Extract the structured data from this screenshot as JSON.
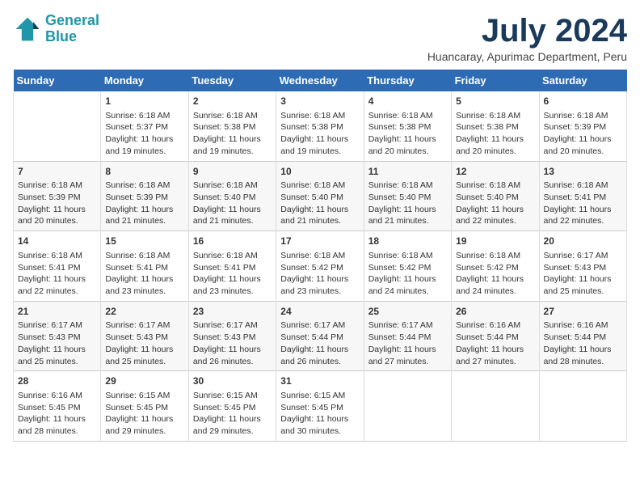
{
  "header": {
    "logo_line1": "General",
    "logo_line2": "Blue",
    "title": "July 2024",
    "subtitle": "Huancaray, Apurimac Department, Peru"
  },
  "columns": [
    "Sunday",
    "Monday",
    "Tuesday",
    "Wednesday",
    "Thursday",
    "Friday",
    "Saturday"
  ],
  "weeks": [
    [
      {
        "num": "",
        "info": ""
      },
      {
        "num": "1",
        "info": "Sunrise: 6:18 AM\nSunset: 5:37 PM\nDaylight: 11 hours\nand 19 minutes."
      },
      {
        "num": "2",
        "info": "Sunrise: 6:18 AM\nSunset: 5:38 PM\nDaylight: 11 hours\nand 19 minutes."
      },
      {
        "num": "3",
        "info": "Sunrise: 6:18 AM\nSunset: 5:38 PM\nDaylight: 11 hours\nand 19 minutes."
      },
      {
        "num": "4",
        "info": "Sunrise: 6:18 AM\nSunset: 5:38 PM\nDaylight: 11 hours\nand 20 minutes."
      },
      {
        "num": "5",
        "info": "Sunrise: 6:18 AM\nSunset: 5:38 PM\nDaylight: 11 hours\nand 20 minutes."
      },
      {
        "num": "6",
        "info": "Sunrise: 6:18 AM\nSunset: 5:39 PM\nDaylight: 11 hours\nand 20 minutes."
      }
    ],
    [
      {
        "num": "7",
        "info": "Sunrise: 6:18 AM\nSunset: 5:39 PM\nDaylight: 11 hours\nand 20 minutes."
      },
      {
        "num": "8",
        "info": "Sunrise: 6:18 AM\nSunset: 5:39 PM\nDaylight: 11 hours\nand 21 minutes."
      },
      {
        "num": "9",
        "info": "Sunrise: 6:18 AM\nSunset: 5:40 PM\nDaylight: 11 hours\nand 21 minutes."
      },
      {
        "num": "10",
        "info": "Sunrise: 6:18 AM\nSunset: 5:40 PM\nDaylight: 11 hours\nand 21 minutes."
      },
      {
        "num": "11",
        "info": "Sunrise: 6:18 AM\nSunset: 5:40 PM\nDaylight: 11 hours\nand 21 minutes."
      },
      {
        "num": "12",
        "info": "Sunrise: 6:18 AM\nSunset: 5:40 PM\nDaylight: 11 hours\nand 22 minutes."
      },
      {
        "num": "13",
        "info": "Sunrise: 6:18 AM\nSunset: 5:41 PM\nDaylight: 11 hours\nand 22 minutes."
      }
    ],
    [
      {
        "num": "14",
        "info": "Sunrise: 6:18 AM\nSunset: 5:41 PM\nDaylight: 11 hours\nand 22 minutes."
      },
      {
        "num": "15",
        "info": "Sunrise: 6:18 AM\nSunset: 5:41 PM\nDaylight: 11 hours\nand 23 minutes."
      },
      {
        "num": "16",
        "info": "Sunrise: 6:18 AM\nSunset: 5:41 PM\nDaylight: 11 hours\nand 23 minutes."
      },
      {
        "num": "17",
        "info": "Sunrise: 6:18 AM\nSunset: 5:42 PM\nDaylight: 11 hours\nand 23 minutes."
      },
      {
        "num": "18",
        "info": "Sunrise: 6:18 AM\nSunset: 5:42 PM\nDaylight: 11 hours\nand 24 minutes."
      },
      {
        "num": "19",
        "info": "Sunrise: 6:18 AM\nSunset: 5:42 PM\nDaylight: 11 hours\nand 24 minutes."
      },
      {
        "num": "20",
        "info": "Sunrise: 6:17 AM\nSunset: 5:43 PM\nDaylight: 11 hours\nand 25 minutes."
      }
    ],
    [
      {
        "num": "21",
        "info": "Sunrise: 6:17 AM\nSunset: 5:43 PM\nDaylight: 11 hours\nand 25 minutes."
      },
      {
        "num": "22",
        "info": "Sunrise: 6:17 AM\nSunset: 5:43 PM\nDaylight: 11 hours\nand 25 minutes."
      },
      {
        "num": "23",
        "info": "Sunrise: 6:17 AM\nSunset: 5:43 PM\nDaylight: 11 hours\nand 26 minutes."
      },
      {
        "num": "24",
        "info": "Sunrise: 6:17 AM\nSunset: 5:44 PM\nDaylight: 11 hours\nand 26 minutes."
      },
      {
        "num": "25",
        "info": "Sunrise: 6:17 AM\nSunset: 5:44 PM\nDaylight: 11 hours\nand 27 minutes."
      },
      {
        "num": "26",
        "info": "Sunrise: 6:16 AM\nSunset: 5:44 PM\nDaylight: 11 hours\nand 27 minutes."
      },
      {
        "num": "27",
        "info": "Sunrise: 6:16 AM\nSunset: 5:44 PM\nDaylight: 11 hours\nand 28 minutes."
      }
    ],
    [
      {
        "num": "28",
        "info": "Sunrise: 6:16 AM\nSunset: 5:45 PM\nDaylight: 11 hours\nand 28 minutes."
      },
      {
        "num": "29",
        "info": "Sunrise: 6:15 AM\nSunset: 5:45 PM\nDaylight: 11 hours\nand 29 minutes."
      },
      {
        "num": "30",
        "info": "Sunrise: 6:15 AM\nSunset: 5:45 PM\nDaylight: 11 hours\nand 29 minutes."
      },
      {
        "num": "31",
        "info": "Sunrise: 6:15 AM\nSunset: 5:45 PM\nDaylight: 11 hours\nand 30 minutes."
      },
      {
        "num": "",
        "info": ""
      },
      {
        "num": "",
        "info": ""
      },
      {
        "num": "",
        "info": ""
      }
    ]
  ]
}
